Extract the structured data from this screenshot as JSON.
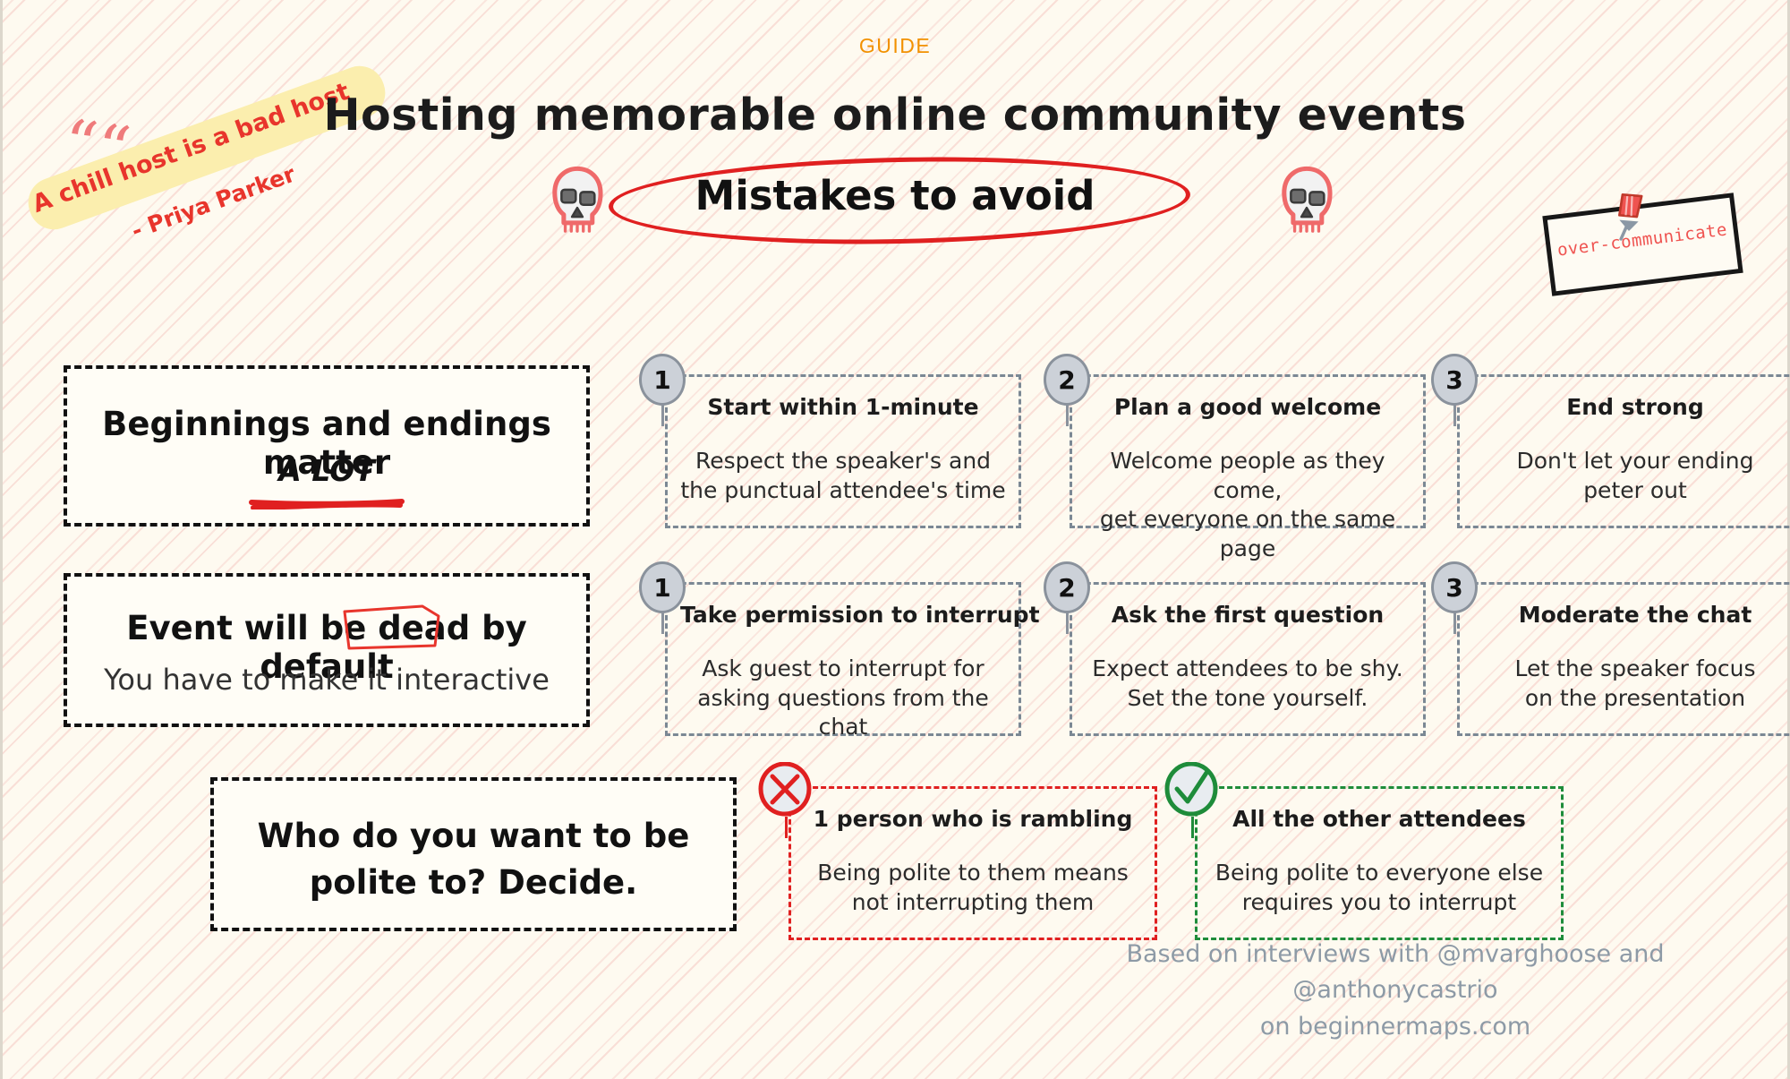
{
  "header": {
    "kicker": "GUIDE",
    "title": "Hosting memorable online community events",
    "subtitle": "Mistakes to avoid"
  },
  "quote": {
    "marks": "””",
    "text": "A chill host is a bad host",
    "author": "- Priya Parker"
  },
  "pin_note": {
    "text": "over-communicate"
  },
  "statements": [
    {
      "line1": "Beginnings and endings matter",
      "emphasis": "A LOT"
    },
    {
      "line1_before": "Event will be ",
      "line1_highlight": "dead",
      "line1_after": " by default",
      "line2": "You have to make it interactive"
    },
    {
      "line1": "Who do you want to be",
      "line2": "polite to? Decide."
    }
  ],
  "rows": [
    {
      "cards": [
        {
          "badge": "1",
          "title": "Start within 1-minute",
          "body": "Respect the speaker's and\nthe punctual attendee's time"
        },
        {
          "badge": "2",
          "title": "Plan a good welcome",
          "body": "Welcome people as they come,\nget everyone on the same page"
        },
        {
          "badge": "3",
          "title": "End strong",
          "body": "Don't let your ending\npeter out"
        }
      ]
    },
    {
      "cards": [
        {
          "badge": "1",
          "title": "Take permission to interrupt",
          "body": "Ask guest to interrupt for\nasking questions from the chat"
        },
        {
          "badge": "2",
          "title": "Ask the first question",
          "body": "Expect attendees to be shy.\nSet the tone yourself."
        },
        {
          "badge": "3",
          "title": "Moderate the chat",
          "body": "Let the speaker focus\non the presentation"
        }
      ]
    },
    {
      "cards": [
        {
          "badge": "cross-icon",
          "title": "1 person who is rambling",
          "body": "Being polite to them means\nnot interrupting them"
        },
        {
          "badge": "check-icon",
          "title": "All the other attendees",
          "body": "Being polite to everyone else\nrequires you to interrupt"
        }
      ]
    }
  ],
  "footer": {
    "line1": "Based on interviews with @mvarghoose and @anthonycastrio",
    "line2": "on beginnermaps.com"
  },
  "colors": {
    "background": "#fefaf0",
    "stripe": "#f2b9b4",
    "kicker": "#f29100",
    "accent_red": "#e02020",
    "accent_green": "#1e8c3a",
    "highlight": "#fbe7a8",
    "badge": "#ccd1d8",
    "footer_text": "#8d9aa6",
    "ink": "#1c1c1c"
  }
}
